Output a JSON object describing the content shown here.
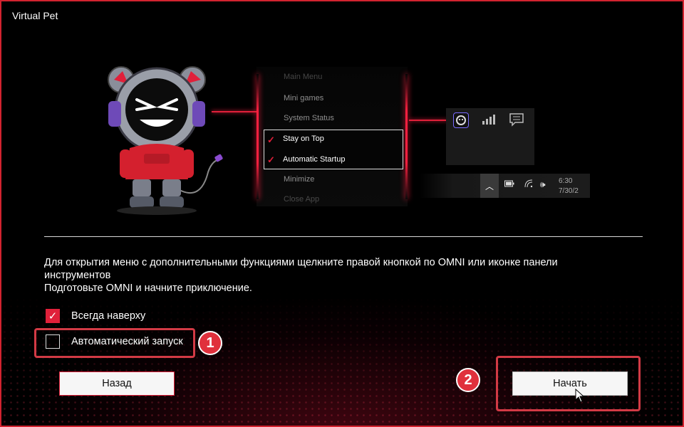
{
  "window": {
    "title": "Virtual Pet"
  },
  "illustration": {
    "context_menu": {
      "items_top": [
        "Main Menu",
        "Mini games",
        "System Status"
      ],
      "checked_items": [
        "Stay on Top",
        "Automatic Startup"
      ],
      "items_bottom": [
        "Minimize",
        "Close App"
      ]
    },
    "taskbar": {
      "time": "6:30",
      "date": "7/30/2"
    }
  },
  "description": {
    "line1": "Для открытия меню с дополнительными функциями щелкните правой кнопкой по OMNI или иконке панели",
    "line2": "инструментов",
    "line3": "Подготовьте OMNI и начните приключение."
  },
  "options": {
    "always_on_top": {
      "label": "Всегда наверху",
      "checked": true
    },
    "auto_start": {
      "label": "Автоматический запуск",
      "checked": false
    }
  },
  "buttons": {
    "back": "Назад",
    "start": "Начать"
  },
  "annotations": {
    "badge1": "1",
    "badge2": "2"
  },
  "colors": {
    "accent": "#e0203a",
    "highlight": "#d23a45",
    "background": "#000000"
  }
}
